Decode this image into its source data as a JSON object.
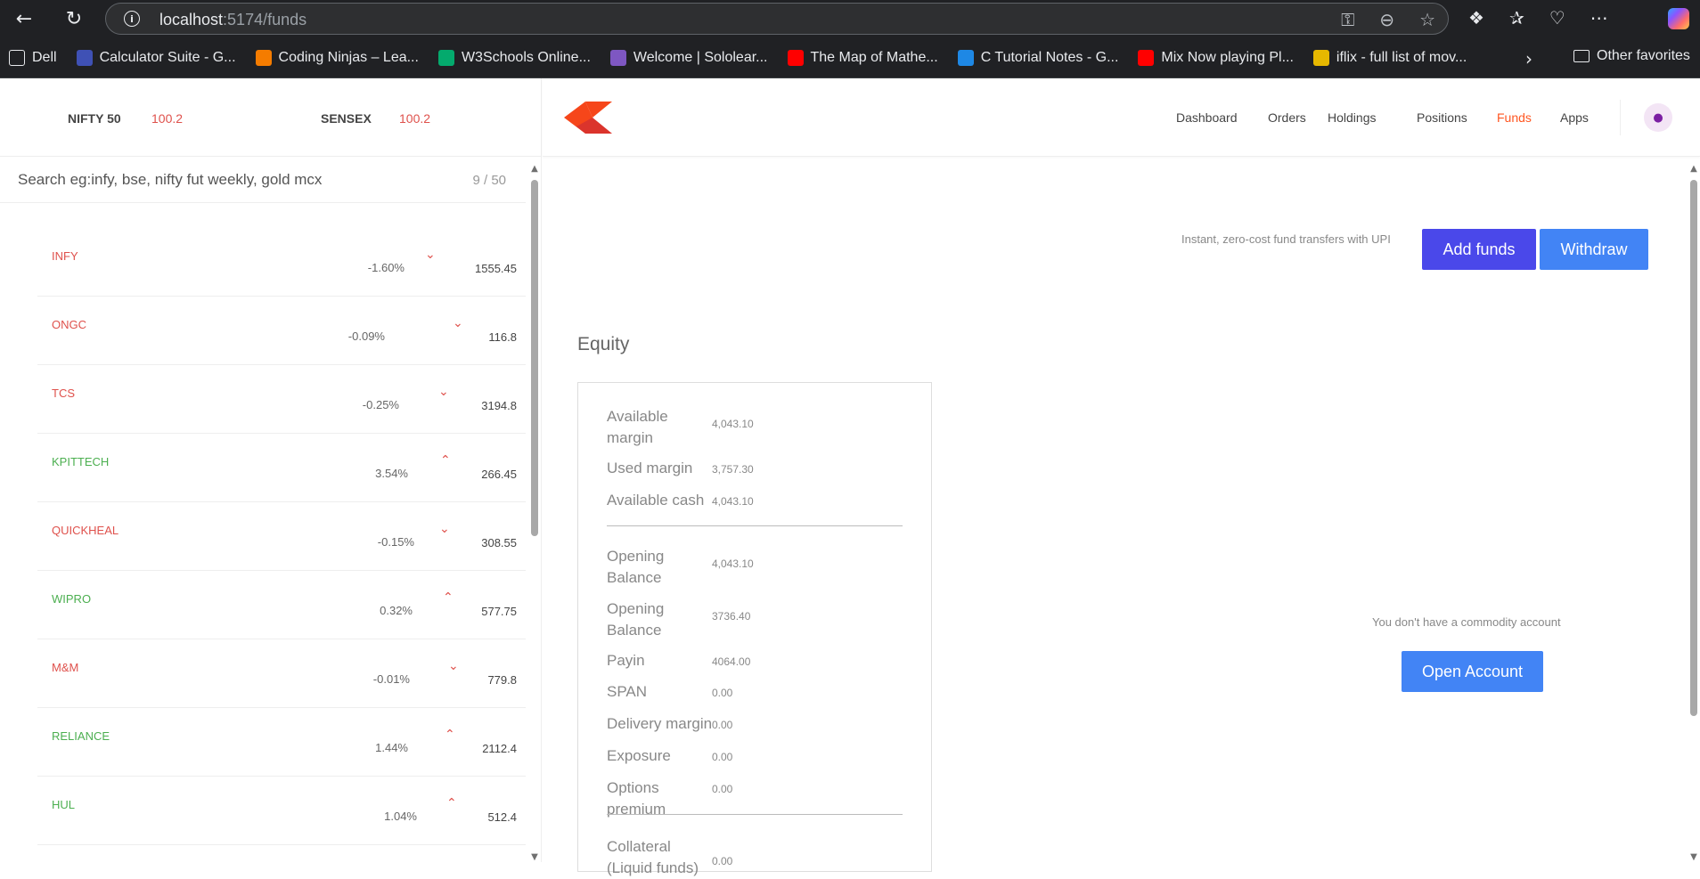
{
  "browser": {
    "url_host": "localhost",
    "url_path": ":5174/funds",
    "bookmarks": [
      {
        "label": "Dell",
        "color": "#202124"
      },
      {
        "label": "Calculator Suite - G...",
        "color": "#3f51b5"
      },
      {
        "label": "Coding Ninjas – Lea...",
        "color": "#f57c00"
      },
      {
        "label": "W3Schools Online...",
        "color": "#04aa6d"
      },
      {
        "label": "Welcome | Sololear...",
        "color": "#7e57c2"
      },
      {
        "label": "The Map of Mathe...",
        "color": "#ff0000"
      },
      {
        "label": "C Tutorial Notes - G...",
        "color": "#1e88e5"
      },
      {
        "label": "Mix Now playing Pl...",
        "color": "#ff0000"
      },
      {
        "label": "iflix - full list of mov...",
        "color": "#e6b800"
      }
    ],
    "other_favorites": "Other favorites"
  },
  "indices": [
    {
      "name": "NIFTY 50",
      "value": "100.2"
    },
    {
      "name": "SENSEX",
      "value": "100.2"
    }
  ],
  "search": {
    "placeholder": "Search eg:infy, bse, nifty fut weekly, gold mcx",
    "count": "9 / 50"
  },
  "watchlist": [
    {
      "name": "INFY",
      "percent": "-1.60%",
      "price": "1555.45",
      "direction": "down"
    },
    {
      "name": "ONGC",
      "percent": "-0.09%",
      "price": "116.8",
      "direction": "down"
    },
    {
      "name": "TCS",
      "percent": "-0.25%",
      "price": "3194.8",
      "direction": "down"
    },
    {
      "name": "KPITTECH",
      "percent": "3.54%",
      "price": "266.45",
      "direction": "up"
    },
    {
      "name": "QUICKHEAL",
      "percent": "-0.15%",
      "price": "308.55",
      "direction": "down"
    },
    {
      "name": "WIPRO",
      "percent": "0.32%",
      "price": "577.75",
      "direction": "up"
    },
    {
      "name": "M&M",
      "percent": "-0.01%",
      "price": "779.8",
      "direction": "down"
    },
    {
      "name": "RELIANCE",
      "percent": "1.44%",
      "price": "2112.4",
      "direction": "up"
    },
    {
      "name": "HUL",
      "percent": "1.04%",
      "price": "512.4",
      "direction": "up"
    }
  ],
  "nav": {
    "items": [
      "Dashboard",
      "Orders",
      "Holdings",
      "Positions",
      "Funds",
      "Apps"
    ],
    "active": "Funds"
  },
  "funds": {
    "upi_text": "Instant, zero-cost fund transfers with UPI",
    "add_label": "Add funds",
    "withdraw_label": "Withdraw",
    "equity_title": "Equity",
    "rows_a": [
      {
        "label": "Available margin",
        "value": "4,043.10"
      },
      {
        "label": "Used margin",
        "value": "3,757.30"
      },
      {
        "label": "Available cash",
        "value": "4,043.10"
      }
    ],
    "rows_b": [
      {
        "label": "Opening Balance",
        "value": "4,043.10"
      },
      {
        "label": "Opening Balance",
        "value": "3736.40"
      },
      {
        "label": "Payin",
        "value": "4064.00"
      },
      {
        "label": "SPAN",
        "value": "0.00"
      },
      {
        "label": "Delivery margin",
        "value": "0.00"
      },
      {
        "label": "Exposure",
        "value": "0.00"
      },
      {
        "label": "Options premium",
        "value": "0.00"
      }
    ],
    "rows_c": [
      {
        "label": "Collateral (Liquid funds)",
        "value": "0.00"
      }
    ],
    "commodity_msg": "You don't have a commodity account",
    "open_account_label": "Open Account"
  },
  "colors": {
    "red": "#df514c",
    "green": "#4caf50",
    "active_nav": "#ff5722",
    "add_btn": "#4a48ea",
    "blue_btn": "#4284f5"
  }
}
